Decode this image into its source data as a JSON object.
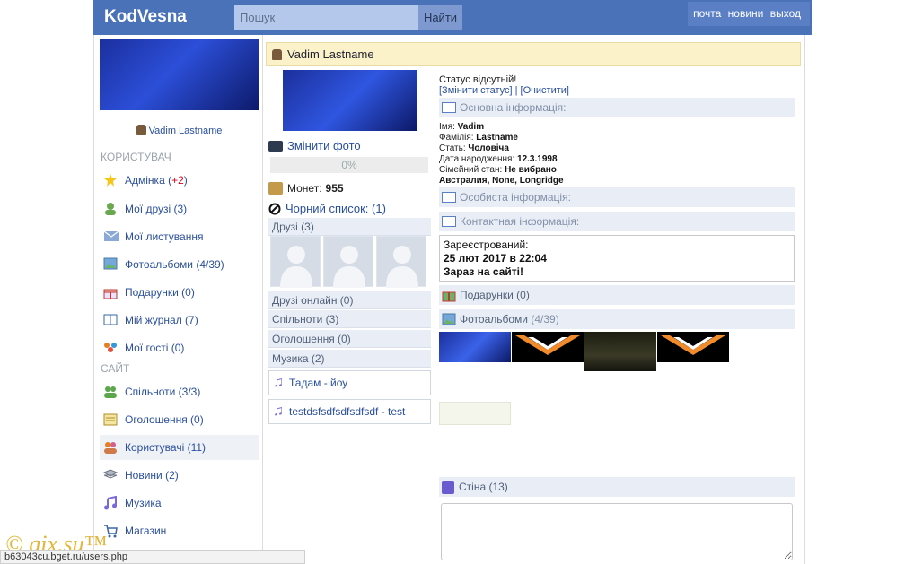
{
  "header": {
    "logo": "KodVesna",
    "search_placeholder": "Пошук",
    "search_button": "Найти",
    "nav": [
      "почта",
      "новини",
      "выход"
    ]
  },
  "sidebar": {
    "user_name": "Vadim Lastname",
    "section_user": "КОРИСТУВАЧ",
    "section_site": "САЙТ",
    "items": [
      {
        "label": "Адмінка (",
        "extra": "+2",
        "suffix": ")",
        "icon": "star-icon"
      },
      {
        "label": "Мої друзі (3)",
        "icon": "friend-icon"
      },
      {
        "label": "Мої листування",
        "icon": "mail-icon"
      },
      {
        "label": "Фотоальбоми (4/39)",
        "icon": "photo-icon"
      },
      {
        "label": "Подарунки (0)",
        "icon": "gift-icon"
      },
      {
        "label": "Мій журнал (7)",
        "icon": "book-icon"
      },
      {
        "label": "Мої гості (0)",
        "icon": "guests-icon"
      },
      {
        "label": "Спільноти (3/3)",
        "icon": "group-icon"
      },
      {
        "label": "Оголошення (0)",
        "icon": "board-icon"
      },
      {
        "label": "Користувачі (11)",
        "icon": "users-icon"
      },
      {
        "label": "Новини (2)",
        "icon": "news-icon"
      },
      {
        "label": "Музика",
        "icon": "music-icon"
      },
      {
        "label": "Магазин",
        "icon": "cart-icon"
      }
    ]
  },
  "profile": {
    "title": "Vadim Lastname",
    "change_photo": "Змінити фото",
    "progress": "0%",
    "coins_label": "Монет:",
    "coins_value": "955",
    "blacklist": "Чорний список: (1)",
    "friends": "Друзі (3)",
    "friends_online": "Друзі онлайн (0)",
    "communities": "Спільноти (3)",
    "ads": "Оголошення (0)",
    "music": "Музика (2)",
    "tracks": [
      "Тадам - йоу",
      "testdsfsdfsdfsdfsdf - test"
    ],
    "status": "Статус відсутній!",
    "status_change": "[Змінити статус]",
    "status_clear": "[Очистити]",
    "basic_info": "Основна інформація:",
    "info": [
      {
        "k": "Імя:",
        "v": "Vadim"
      },
      {
        "k": "Фамілія:",
        "v": "Lastname"
      },
      {
        "k": "Стать:",
        "v": "Чоловіча"
      },
      {
        "k": "Дата народження:",
        "v": "12.3.1998"
      },
      {
        "k": "Сімейний стан:",
        "v": "Не вибрано"
      },
      {
        "k": "",
        "v": "Австралия, None, Longridge"
      }
    ],
    "personal_info": "Особиста інформація:",
    "contact_info": "Контактная інформація:",
    "registered_label": "Зареєстрований:",
    "registered_date": "25 лют 2017 в 22:04",
    "online_now": "Зараз на сайті!",
    "gifts": "Подарунки (0)",
    "albums_label": "Фотоальбоми",
    "albums_count": "(4/39)",
    "wall": "Стіна (13)"
  },
  "statusbar": {
    "url": "b63043cu.bget.ru/users.php",
    "watermark": "© gix.su™"
  }
}
